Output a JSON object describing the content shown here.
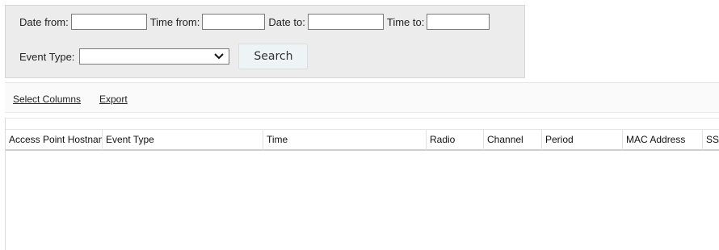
{
  "filters": {
    "date_from_label": "Date from:",
    "date_from_value": "",
    "time_from_label": "Time from:",
    "time_from_value": "",
    "date_to_label": "Date to:",
    "date_to_value": "",
    "time_to_label": "Time to:",
    "time_to_value": "",
    "event_type_label": "Event Type:",
    "event_type_selected": "",
    "search_label": "Search"
  },
  "toolbar": {
    "select_columns_label": "Select Columns",
    "export_label": "Export"
  },
  "table": {
    "columns": [
      "Access Point Hostname",
      "Event Type",
      "Time",
      "Radio",
      "Channel",
      "Period",
      "MAC Address",
      "SSID"
    ],
    "rows": []
  },
  "icons": {
    "dropdown": "chevron-down-icon"
  },
  "colors": {
    "panel_bg": "#ececec",
    "toolbar_bg": "#fafafa",
    "button_bg": "#eef3f5"
  }
}
